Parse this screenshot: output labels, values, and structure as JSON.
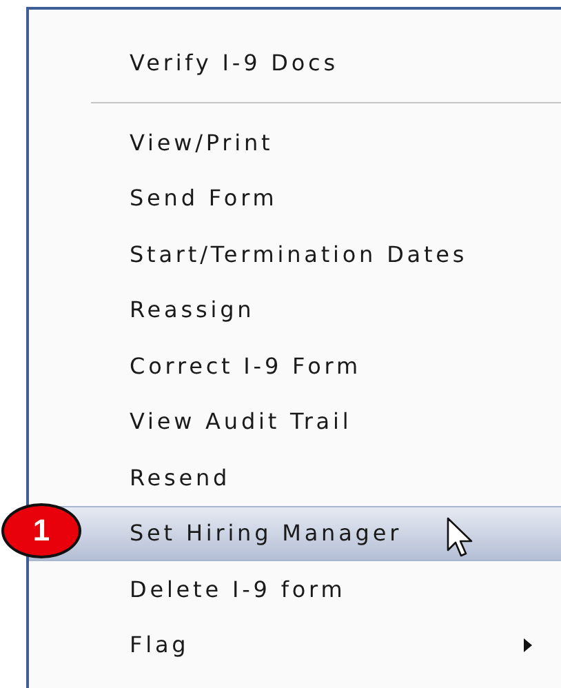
{
  "menu": {
    "items": [
      {
        "kind": "item",
        "label": "Verify I-9 Docs",
        "selected": false
      },
      {
        "kind": "separator"
      },
      {
        "kind": "item",
        "label": "View/Print",
        "selected": false
      },
      {
        "kind": "item",
        "label": "Send Form",
        "selected": false
      },
      {
        "kind": "item",
        "label": "Start/Termination Dates",
        "selected": false
      },
      {
        "kind": "item",
        "label": "Reassign",
        "selected": false
      },
      {
        "kind": "item",
        "label": "Correct I-9 Form",
        "selected": false
      },
      {
        "kind": "item",
        "label": "View Audit Trail",
        "selected": false
      },
      {
        "kind": "item",
        "label": "Resend",
        "selected": false
      },
      {
        "kind": "item",
        "label": "Set Hiring Manager",
        "selected": true
      },
      {
        "kind": "item",
        "label": "Delete I-9 form",
        "selected": false
      },
      {
        "kind": "submenu",
        "label": "Flag",
        "selected": false
      }
    ]
  },
  "callout": {
    "number": "1"
  }
}
